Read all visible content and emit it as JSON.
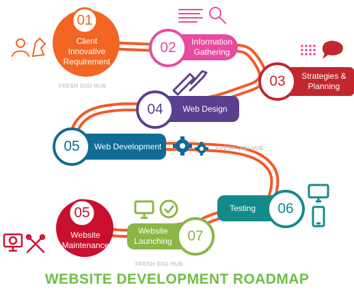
{
  "title": "WEBSITE DEVELOPMENT ROADMAP",
  "watermark": "FRESH DIGI HUB",
  "colors": {
    "road": "#f15a29",
    "title": "#6fbe44",
    "step1": "#f26522",
    "step2": "#e84a9e",
    "step3": "#c1272d",
    "step4": "#5b3f8f",
    "step5": "#0e6c96",
    "step6": "#138a8a",
    "step7": "#8bb545",
    "step8": "#c8102e"
  },
  "steps": [
    {
      "number": "01",
      "label": "Client Innovative Requirement",
      "icon": "user-pointer-icon"
    },
    {
      "number": "02",
      "label": "Information Gathering",
      "icon": "search-list-icon"
    },
    {
      "number": "03",
      "label": "Strategies & Planning",
      "icon": "chat-dots-icon"
    },
    {
      "number": "04",
      "label": "Web Design",
      "icon": "pen-brush-icon"
    },
    {
      "number": "05",
      "label": "Web Development",
      "icon": "gears-icon"
    },
    {
      "number": "06",
      "label": "Testing",
      "icon": "monitor-phone-icon"
    },
    {
      "number": "07",
      "label": "Website Launching",
      "icon": "screen-check-icon"
    },
    {
      "number": "05",
      "label": "Website Maintenance",
      "icon": "tools-icon"
    }
  ]
}
